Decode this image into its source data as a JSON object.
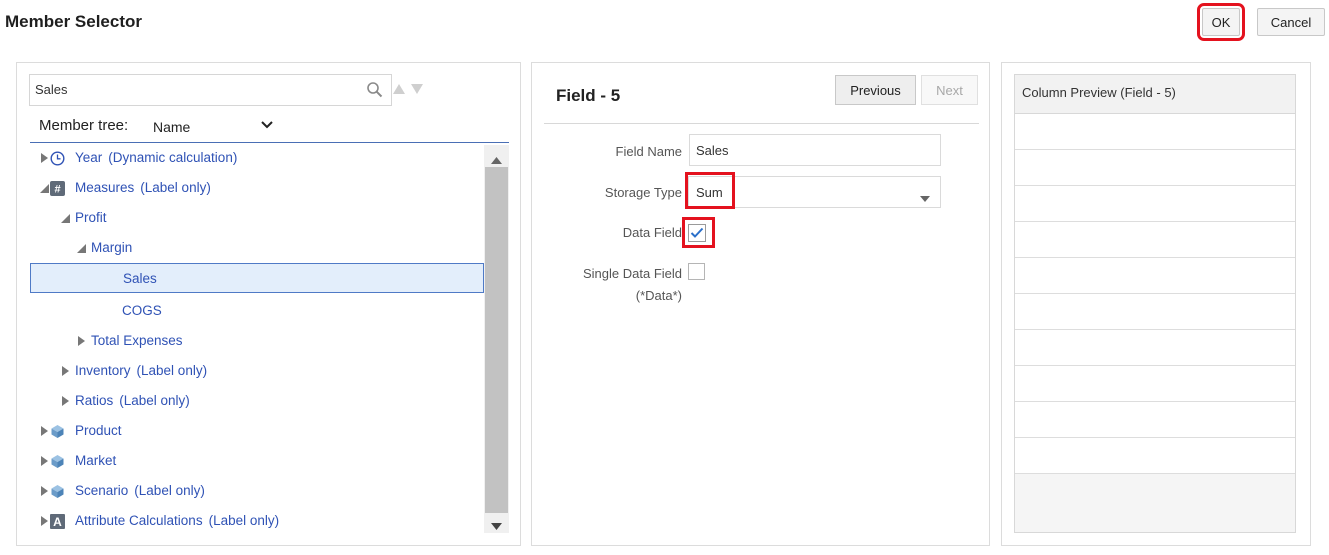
{
  "header": {
    "title": "Member Selector",
    "ok_label": "OK",
    "cancel_label": "Cancel"
  },
  "search": {
    "value": "Sales"
  },
  "member_tree": {
    "label": "Member tree:",
    "selected": "Name"
  },
  "tree": [
    {
      "label": "Year",
      "suffix": "(Dynamic calculation)",
      "icon": "clock-icon",
      "expander": "collapsed"
    },
    {
      "label": "Measures",
      "suffix": "(Label only)",
      "icon": "hash-icon",
      "expander": "expanded"
    },
    {
      "label": "Profit",
      "suffix": "",
      "icon": "",
      "expander": "expanded"
    },
    {
      "label": "Margin",
      "suffix": "",
      "icon": "",
      "expander": "expanded"
    },
    {
      "label": "Sales",
      "suffix": "",
      "icon": "",
      "expander": "none",
      "selected": true
    },
    {
      "label": "COGS",
      "suffix": "",
      "icon": "",
      "expander": "none"
    },
    {
      "label": "Total Expenses",
      "suffix": "",
      "icon": "",
      "expander": "collapsed"
    },
    {
      "label": "Inventory",
      "suffix": "(Label only)",
      "icon": "",
      "expander": "collapsed"
    },
    {
      "label": "Ratios",
      "suffix": "(Label only)",
      "icon": "",
      "expander": "collapsed"
    },
    {
      "label": "Product",
      "suffix": "",
      "icon": "cube-icon",
      "expander": "collapsed"
    },
    {
      "label": "Market",
      "suffix": "",
      "icon": "cube-icon",
      "expander": "collapsed"
    },
    {
      "label": "Scenario",
      "suffix": "(Label only)",
      "icon": "cube-icon",
      "expander": "collapsed"
    },
    {
      "label": "Attribute Calculations",
      "suffix": "(Label only)",
      "icon": "attribute-icon",
      "expander": "collapsed"
    }
  ],
  "field": {
    "title": "Field - 5",
    "previous_label": "Previous",
    "next_label": "Next",
    "field_name_label": "Field Name",
    "field_name_value": "Sales",
    "storage_type_label": "Storage Type",
    "storage_type_value": "Sum",
    "data_field_label": "Data Field",
    "data_field_checked": true,
    "single_data_field_label": "Single Data Field",
    "single_data_field_sublabel": "(*Data*)",
    "single_data_field_checked": false
  },
  "preview": {
    "header": "Column Preview (Field - 5)"
  },
  "colors": {
    "highlight": "#e4121e",
    "link": "#2f52b5",
    "selected_row": "#e3eefb"
  }
}
